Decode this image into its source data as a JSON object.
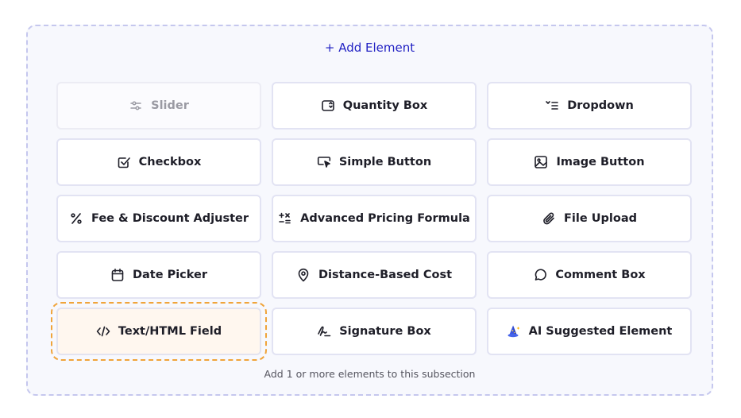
{
  "panel": {
    "add_element_label": "+ Add Element",
    "hint": "Add 1 or more elements to this subsection"
  },
  "elements": [
    {
      "label": "Slider",
      "icon": "sliders-icon",
      "state": "disabled"
    },
    {
      "label": "Quantity Box",
      "icon": "quantity-box-icon",
      "state": "normal"
    },
    {
      "label": "Dropdown",
      "icon": "dropdown-list-icon",
      "state": "normal"
    },
    {
      "label": "Checkbox",
      "icon": "checkbox-icon",
      "state": "normal"
    },
    {
      "label": "Simple Button",
      "icon": "cursor-button-icon",
      "state": "normal"
    },
    {
      "label": "Image Button",
      "icon": "image-icon",
      "state": "normal"
    },
    {
      "label": "Fee & Discount Adjuster",
      "icon": "percent-icon",
      "state": "normal"
    },
    {
      "label": "Advanced Pricing Formula",
      "icon": "formula-icon",
      "state": "normal"
    },
    {
      "label": "File Upload",
      "icon": "paperclip-icon",
      "state": "normal"
    },
    {
      "label": "Date Picker",
      "icon": "calendar-icon",
      "state": "normal"
    },
    {
      "label": "Distance-Based Cost",
      "icon": "map-pin-icon",
      "state": "normal"
    },
    {
      "label": "Comment Box",
      "icon": "comment-icon",
      "state": "normal"
    },
    {
      "label": "Text/HTML Field",
      "icon": "code-icon",
      "state": "selected"
    },
    {
      "label": "Signature Box",
      "icon": "signature-icon",
      "state": "normal"
    },
    {
      "label": "AI Suggested Element",
      "icon": "wizard-icon",
      "state": "normal"
    }
  ],
  "colors": {
    "accent": "#2323c4",
    "selected_outline": "#f0a43a",
    "panel_border": "#c5c7ee",
    "wizard_blue": "#3a55e0"
  }
}
